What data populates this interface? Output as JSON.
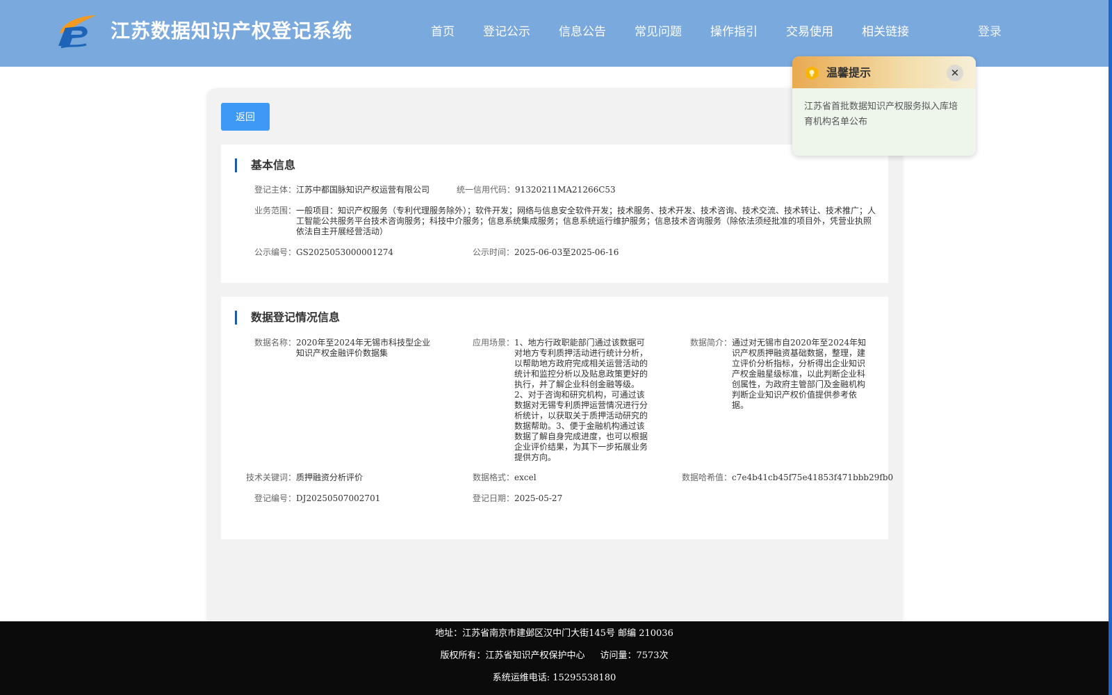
{
  "header": {
    "title": "江苏数据知识产权登记系统",
    "nav": [
      "首页",
      "登记公示",
      "信息公告",
      "常见问题",
      "操作指引",
      "交易使用",
      "相关链接"
    ],
    "login": "登录",
    "background": "#7aa9de"
  },
  "back_button": "返回",
  "basic_info": {
    "title": "基本信息",
    "subject_label": "登记主体：",
    "subject_value": "江苏中都国脉知识产权运营有限公司",
    "credit_label": "统一信用代码：",
    "credit_value": "91320211MA21266C53",
    "scope_label": "业务范围：",
    "scope_value": "一般项目：知识产权服务（专利代理服务除外）；软件开发；网络与信息安全软件开发；技术服务、技术开发、技术咨询、技术交流、技术转让、技术推广；人工智能公共服务平台技术咨询服务；科技中介服务；信息系统集成服务；信息系统运行维护服务；信息技术咨询服务（除依法须经批准的项目外，凭营业执照依法自主开展经营活动）",
    "pub_no_label": "公示编号：",
    "pub_no_value": "GS2025053000001274",
    "pub_time_label": "公示时间：",
    "pub_time_value": "2025-06-03至2025-06-16"
  },
  "data_info": {
    "title": "数据登记情况信息",
    "name_label": "数据名称：",
    "name_value": "2020年至2024年无锡市科技型企业知识产权金融评价数据集",
    "scene_label": "应用场景：",
    "scene_value": "1、地方行政职能部门通过该数据可对地方专利质押活动进行统计分析，以帮助地方政府完成相关运营活动的统计和监控分析以及贴息政策更好的执行，并了解企业科创金融等级。2、对于咨询和研究机构，可通过该数据对无锡专利质押运营情况进行分析统计，以获取关于质押活动研究的数据帮助。3、便于金融机构通过该数据了解自身完成进度，也可以根据企业评价结果，为其下一步拓展业务提供方向。",
    "intro_label": "数据简介：",
    "intro_value": "通过对无锡市自2020年至2024年知识产权质押融资基础数据，整理，建立评价分析指标，分析得出企业知识产权金融星级标准，以此判断企业科创属性，为政府主管部门及金融机构判断企业知识产权价值提供参考依据。",
    "keyword_label": "技术关键词：",
    "keyword_value": "质押融资分析评价",
    "format_label": "数据格式：",
    "format_value": "excel",
    "hash_label": "数据哈希值：",
    "hash_value": "c7e4b41cb45f75e41853f471bbb29fb0",
    "reg_no_label": "登记编号：",
    "reg_no_value": "DJ20250507002701",
    "reg_date_label": "登记日期：",
    "reg_date_value": "2025-05-27"
  },
  "tip": {
    "title": "温馨提示",
    "close": "✕",
    "body": "江苏省首批数据知识产权服务拟入库培育机构名单公布",
    "icon": "lightbulb-icon"
  },
  "footer": {
    "address": "地址：江苏省南京市建邺区汉中门大街145号 邮编 210036",
    "copyright": "版权所有：江苏省知识产权保护中心",
    "visits": "访问量：7573次",
    "phone": "系统运维电话: 15295538180"
  }
}
